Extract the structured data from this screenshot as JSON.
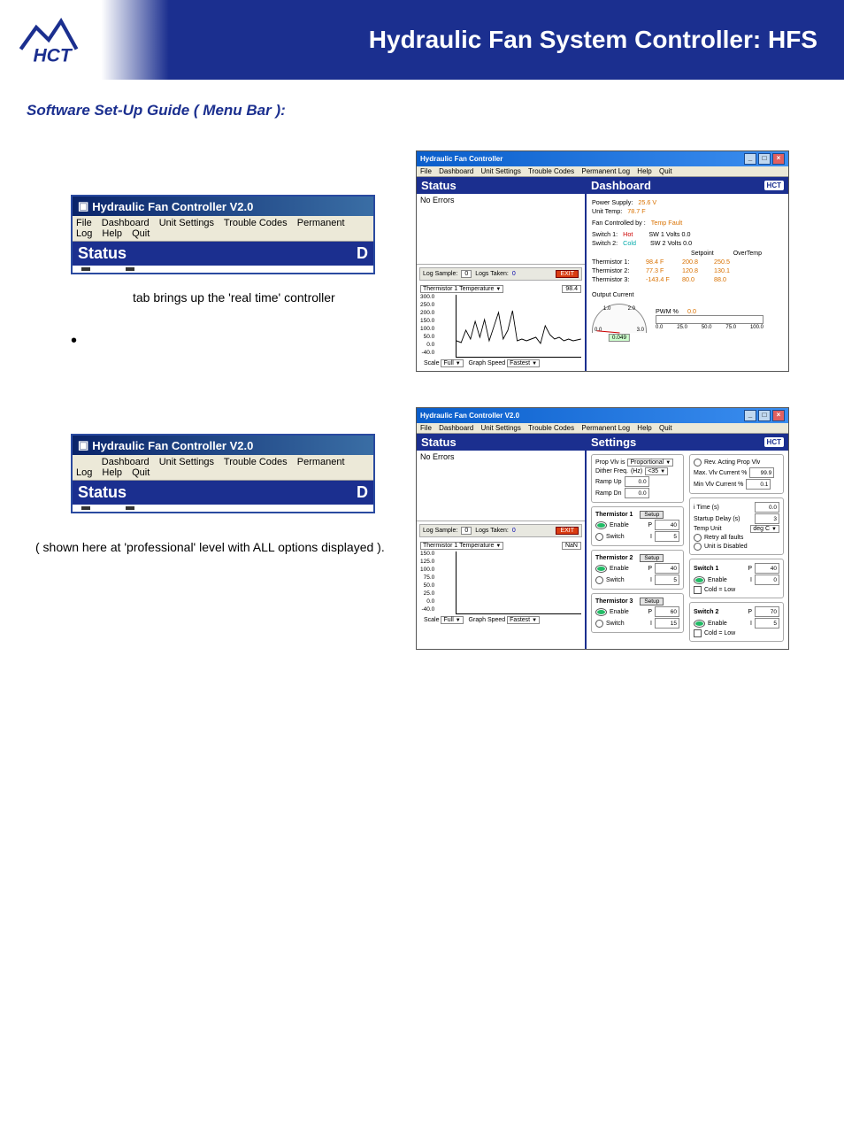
{
  "banner": {
    "title": "Hydraulic Fan System Controller: HFS"
  },
  "subtitle": "Software Set-Up Guide ( Menu Bar ):",
  "miniWindow": {
    "title": "Hydraulic Fan Controller V2.0",
    "menu": [
      "File",
      "Dashboard",
      "Unit Settings",
      "Trouble Codes",
      "Permanent Log",
      "Help",
      "Quit"
    ],
    "status": "Status",
    "rightLetter": "D"
  },
  "caption1": "tab brings up the 'real time' controller",
  "caption2": "( shown here at 'professional' level with ALL options displayed ).",
  "dashboardWindow": {
    "title": "Hydraulic Fan Controller",
    "menu": [
      "File",
      "Dashboard",
      "Unit Settings",
      "Trouble Codes",
      "Permanent Log",
      "Help",
      "Quit"
    ],
    "leftHeader": "Status",
    "rightHeader": "Dashboard",
    "noErrors": "No Errors",
    "logSampleLabel": "Log Sample:",
    "logSampleVal": "0",
    "logsTakenLabel": "Logs Taken:",
    "logsTakenVal": "0",
    "exit": "EXIT",
    "thermDropdown": "Thermistor 1 Temperature",
    "thermReading": "98.4",
    "thermReading2": "NaN",
    "yticks": [
      "300.0",
      "250.0",
      "200.0",
      "150.0",
      "100.0",
      "50.0",
      "0.0",
      "-40.0"
    ],
    "yticks2": [
      "150.0",
      "125.0",
      "100.0",
      "75.0",
      "50.0",
      "25.0",
      "0.0",
      "-40.0"
    ],
    "scaleLabel": "Scale",
    "scaleVal": "Full",
    "graphSpeedLabel": "Graph Speed",
    "graphSpeedVal": "Fastest",
    "dash": {
      "powerSupply": {
        "label": "Power Supply:",
        "val": "25.6 V"
      },
      "unitTemp": {
        "label": "Unit Temp:",
        "val": "78.7 F"
      },
      "fanControlled": {
        "label": "Fan Controlled by :",
        "val": "Temp Fault"
      },
      "sw1": {
        "label": "Switch 1:",
        "state": "Hot",
        "volts": "SW 1 Volts 0.0"
      },
      "sw2": {
        "label": "Switch 2:",
        "state": "Cold",
        "volts": "SW 2 Volts 0.0"
      },
      "colHeads": [
        "",
        "Setpoint",
        "OverTemp"
      ],
      "therm": [
        {
          "name": "Thermistor 1:",
          "val": "98.4 F",
          "setpoint": "200.8",
          "over": "250.5"
        },
        {
          "name": "Thermistor 2:",
          "val": "77.3 F",
          "setpoint": "120.8",
          "over": "130.1"
        },
        {
          "name": "Thermistor 3:",
          "val": "-143.4 F",
          "setpoint": "80.0",
          "over": "88.0"
        }
      ],
      "outputCurrent": "Output Current",
      "gauge": {
        "t0": "0.0",
        "t1": "1.0",
        "t2": "2.0",
        "t3": "3.0",
        "readout": "0.049"
      },
      "pwmLabel": "PWM %",
      "pwmVal": "0.0",
      "pwmTicks": [
        "0.0",
        "25.0",
        "50.0",
        "75.0",
        "100.0"
      ]
    }
  },
  "settingsWindow": {
    "title": "Hydraulic Fan Controller V2.0",
    "menu": [
      "File",
      "Dashboard",
      "Unit Settings",
      "Trouble Codes",
      "Permanent Log",
      "Help",
      "Quit"
    ],
    "leftHeader": "Status",
    "rightHeader": "Settings",
    "noErrors": "No Errors",
    "left": {
      "propVlv": {
        "label": "Prop Vlv is",
        "val": "Proportional"
      },
      "dither": {
        "label": "Dither Freq.",
        "unit": "(Hz)",
        "val": "<35"
      },
      "rampUp": {
        "label": "Ramp Up",
        "val": "0.0"
      },
      "rampDn": {
        "label": "Ramp Dn",
        "val": "0.0"
      },
      "revActing": "Rev. Acting Prop Vlv",
      "maxVlv": {
        "label": "Max. Vlv Current %",
        "val": "99.9"
      },
      "minVlv": {
        "label": "Min Vlv  Current %",
        "val": "0.1"
      }
    },
    "therms": [
      {
        "name": "Thermistor 1",
        "setup": "Setup",
        "enable": "Enable",
        "switch": "Switch",
        "p": "40",
        "i": "5"
      },
      {
        "name": "Thermistor 2",
        "setup": "Setup",
        "enable": "Enable",
        "switch": "Switch",
        "p": "40",
        "i": "5"
      },
      {
        "name": "Thermistor 3",
        "setup": "Setup",
        "enable": "Enable",
        "switch": "Switch",
        "p": "60",
        "i": "15"
      }
    ],
    "rightCol": {
      "iTime": {
        "label": "i Time (s)",
        "val": "0.0"
      },
      "startup": {
        "label": "Startup Delay (s)",
        "val": "3"
      },
      "tempUnit": {
        "label": "Temp Unit",
        "val": "deg C"
      },
      "retry": "Retry all faults",
      "unitDisabled": "Unit is Disabled",
      "sw1": {
        "name": "Switch 1",
        "enable": "Enable",
        "coldLow": "Cold = Low",
        "p": "40",
        "i": "0"
      },
      "sw2": {
        "name": "Switch 2",
        "enable": "Enable",
        "coldLow": "Cold = Low",
        "p": "70",
        "i": "5"
      }
    }
  }
}
